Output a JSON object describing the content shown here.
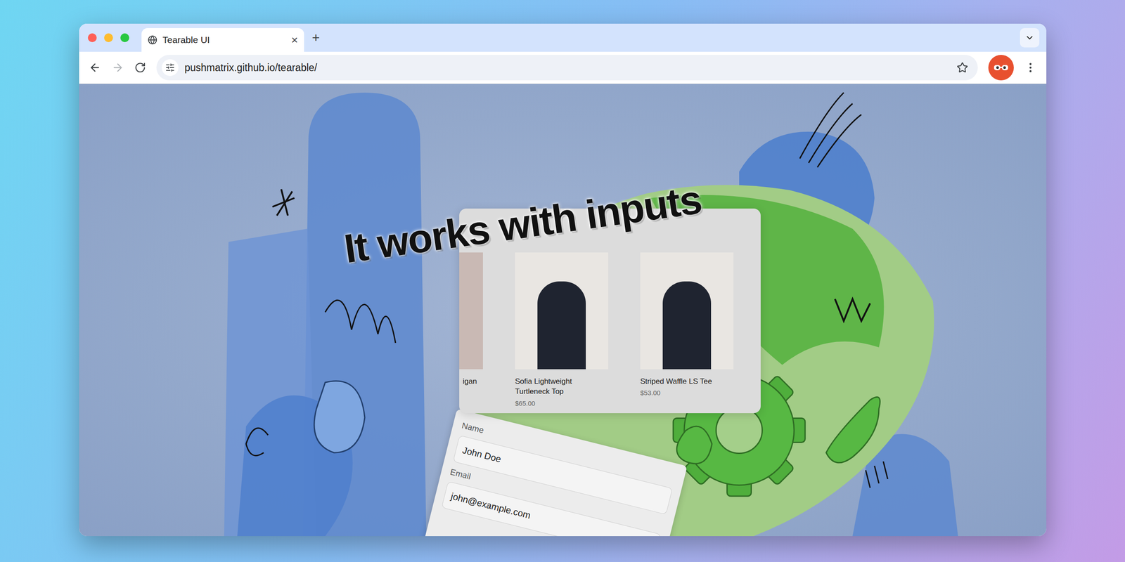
{
  "tabs": [
    {
      "label": "Tearable UI",
      "selected": true,
      "close": "×"
    }
  ],
  "new_tab": "+",
  "address_bar": {
    "url": "pushmatrix.github.io/tearable/"
  },
  "page": {
    "heading": "It works with inputs",
    "products": [
      {
        "name": "igan",
        "kind": "partial"
      },
      {
        "name": "Sofia Lightweight Turtleneck Top",
        "price": "$65.00",
        "kind": "full"
      },
      {
        "name": "Striped Waffle LS Tee",
        "price": "$53.00",
        "kind": "full"
      }
    ],
    "form": [
      {
        "label": "Name",
        "value": "John Doe"
      },
      {
        "label": "Email",
        "value": "john@example.com"
      }
    ]
  }
}
